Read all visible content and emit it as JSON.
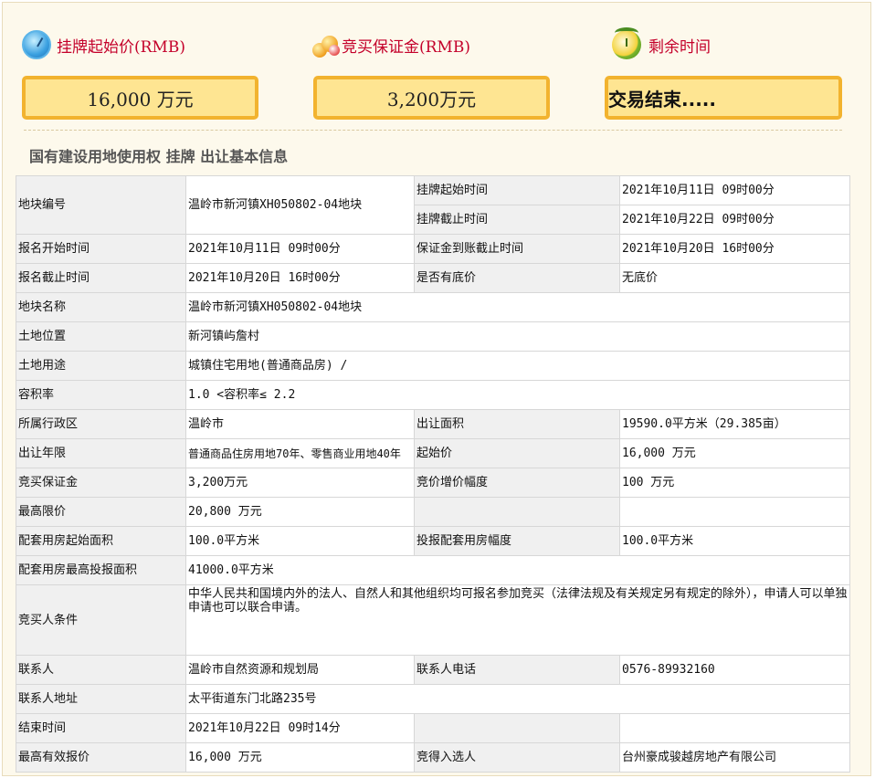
{
  "header": {
    "start_price_label": "挂牌起始价(RMB)",
    "deposit_label": "竞买保证金(RMB)",
    "remaining_label": "剩余时间",
    "start_price_value": "16,000 万元",
    "deposit_value": "3,200万元",
    "remaining_value": "交易结束....."
  },
  "section_title": "国有建设用地使用权 挂牌 出让基本信息",
  "rows": {
    "parcel_no": {
      "k": "地块编号",
      "v": "温岭市新河镇XH050802-04地块"
    },
    "listing_start": {
      "k": "挂牌起始时间",
      "v": "2021年10月11日 09时00分"
    },
    "listing_end": {
      "k": "挂牌截止时间",
      "v": "2021年10月22日 09时00分"
    },
    "reg_start": {
      "k": "报名开始时间",
      "v": "2021年10月11日 09时00分"
    },
    "deposit_deadline": {
      "k": "保证金到账截止时间",
      "v": "2021年10月20日 16时00分"
    },
    "reg_end": {
      "k": "报名截止时间",
      "v": "2021年10月20日 16时00分"
    },
    "reserve": {
      "k": "是否有底价",
      "v": "无底价"
    },
    "parcel_name": {
      "k": "地块名称",
      "v": "温岭市新河镇XH050802-04地块"
    },
    "location": {
      "k": "土地位置",
      "v": "新河镇屿詹村"
    },
    "usage": {
      "k": "土地用途",
      "v": "城镇住宅用地(普通商品房) /"
    },
    "far": {
      "k": "容积率",
      "v": "1.0 <容积率≤ 2.2"
    },
    "district": {
      "k": "所属行政区",
      "v": "温岭市"
    },
    "area": {
      "k": "出让面积",
      "v": "19590.0平方米（29.385亩）"
    },
    "term": {
      "k": "出让年限",
      "v": "普通商品住房用地70年、零售商业用地40年"
    },
    "start_price": {
      "k": "起始价",
      "v": "16,000 万元"
    },
    "deposit": {
      "k": "竞买保证金",
      "v": "3,200万元"
    },
    "increment": {
      "k": "竞价增价幅度",
      "v": "100 万元"
    },
    "max_price": {
      "k": "最高限价",
      "v": "20,800 万元"
    },
    "housing_start": {
      "k": "配套用房起始面积",
      "v": "100.0平方米"
    },
    "housing_step": {
      "k": "投报配套用房幅度",
      "v": "100.0平方米"
    },
    "housing_max": {
      "k": "配套用房最高投报面积",
      "v": "41000.0平方米"
    },
    "bidder_cond": {
      "k": "竞买人条件",
      "v": "中华人民共和国境内外的法人、自然人和其他组织均可报名参加竞买（法律法规及有关规定另有规定的除外），申请人可以单独申请也可以联合申请。"
    },
    "contact": {
      "k": "联系人",
      "v": "温岭市自然资源和规划局"
    },
    "phone": {
      "k": "联系人电话",
      "v": "0576-89932160"
    },
    "address": {
      "k": "联系人地址",
      "v": "太平街道东门北路235号"
    },
    "end_time": {
      "k": "结束时间",
      "v": "2021年10月22日 09时14分"
    },
    "top_bid": {
      "k": "最高有效报价",
      "v": "16,000 万元"
    },
    "winner": {
      "k": "竞得入选人",
      "v": "台州豪成骏越房地产有限公司"
    }
  }
}
